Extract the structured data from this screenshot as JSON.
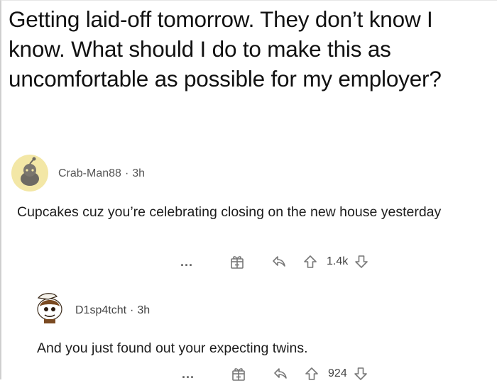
{
  "post": {
    "title": "Getting laid-off tomorrow. They don’t know I know. What should I do to make this as uncomfortable as possible for my employer?"
  },
  "comments": [
    {
      "username": "Crab-Man88",
      "separator": "·",
      "age": "3h",
      "body": "Cupcakes cuz you’re celebrating closing on the new house yesterday",
      "more_label": "...",
      "score": "1.4k"
    },
    {
      "username": "D1sp4tcht",
      "separator": "·",
      "age": "3h",
      "body": "And you just found out your expecting twins.",
      "more_label": "...",
      "score": "924"
    }
  ],
  "icons": {
    "more": "ellipsis-icon",
    "award": "gift-award-icon",
    "reply": "reply-arrow-icon",
    "upvote": "upvote-arrow-icon",
    "downvote": "downvote-arrow-icon"
  }
}
